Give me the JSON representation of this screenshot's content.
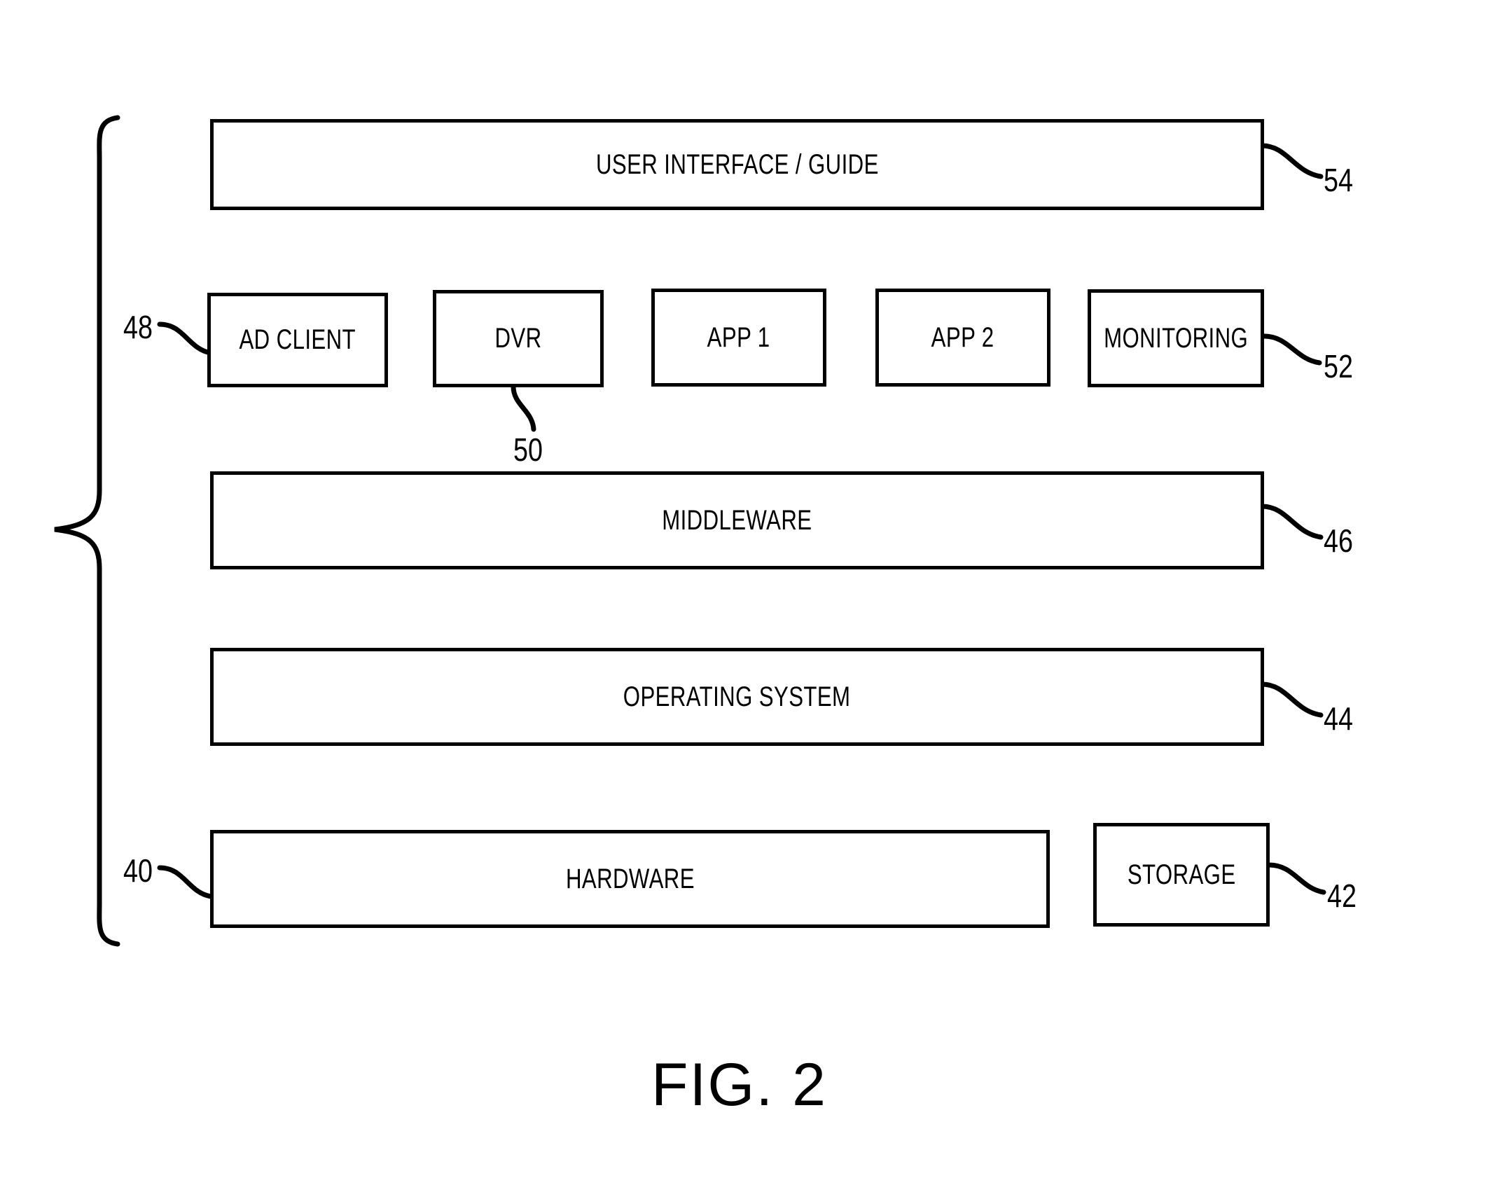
{
  "figure": {
    "caption": "FIG. 2"
  },
  "blocks": [
    {
      "id": "user-interface-guide",
      "label": "USER INTERFACE / GUIDE",
      "ref": "54"
    },
    {
      "id": "ad-client",
      "label": "AD CLIENT",
      "ref": "48"
    },
    {
      "id": "dvr",
      "label": "DVR",
      "ref": "50"
    },
    {
      "id": "app-1",
      "label": "APP 1",
      "ref": ""
    },
    {
      "id": "app-2",
      "label": "APP 2",
      "ref": ""
    },
    {
      "id": "monitoring",
      "label": "MONITORING",
      "ref": "52"
    },
    {
      "id": "middleware",
      "label": "MIDDLEWARE",
      "ref": "46"
    },
    {
      "id": "operating-system",
      "label": "OPERATING SYSTEM",
      "ref": "44"
    },
    {
      "id": "hardware",
      "label": "HARDWARE",
      "ref": "40"
    },
    {
      "id": "storage",
      "label": "STORAGE",
      "ref": "42"
    }
  ],
  "reference_numerals": {
    "ui_guide": "54",
    "application_layer": "52",
    "ad_client": "48",
    "dvr": "50",
    "middleware": "46",
    "operating_system": "44",
    "hardware": "40",
    "storage": "42"
  },
  "colors": {
    "stroke": "#000000",
    "fill": "#ffffff",
    "text": "#000000"
  }
}
